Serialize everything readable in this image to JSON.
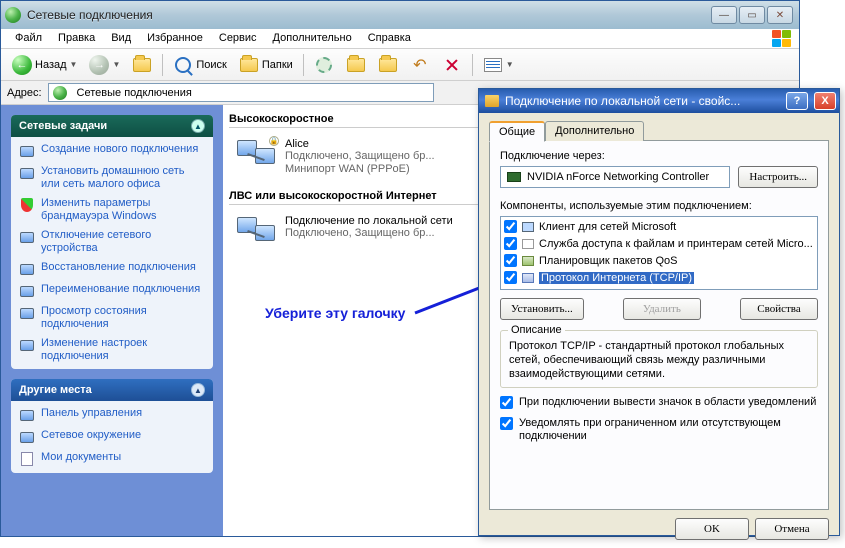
{
  "window": {
    "title": "Сетевые подключения",
    "menu": [
      "Файл",
      "Правка",
      "Вид",
      "Избранное",
      "Сервис",
      "Дополнительно",
      "Справка"
    ],
    "toolbar": {
      "back": "Назад",
      "search": "Поиск",
      "folders": "Папки"
    },
    "address_label": "Адрес:",
    "address_value": "Сетевые подключения"
  },
  "sidebar": {
    "tasks_heading": "Сетевые задачи",
    "tasks": [
      "Создание нового подключения",
      "Установить домашнюю сеть или сеть малого офиса",
      "Изменить параметры брандмауэра Windows",
      "Отключение сетевого устройства",
      "Восстановление подключения",
      "Переименование подключения",
      "Просмотр состояния подключения",
      "Изменение настроек подключения"
    ],
    "other_heading": "Другие места",
    "other": [
      "Панель управления",
      "Сетевое окружение",
      "Мои документы"
    ]
  },
  "content": {
    "group1": "Высокоскоростное",
    "conn1": {
      "name": "Alice",
      "line1": "Подключено, Защищено бр...",
      "line2": "Минипорт WAN (PPPoE)"
    },
    "group2": "ЛВС или высокоскоростной Интернет",
    "conn2": {
      "name": "Подключение по локальной сети",
      "line1": "Подключено, Защищено бр..."
    }
  },
  "annotation": "Уберите эту галочку",
  "dialog": {
    "title": "Подключение по локальной сети - свойс...",
    "tabs": [
      "Общие",
      "Дополнительно"
    ],
    "connect_via": "Подключение через:",
    "adapter": "NVIDIA nForce Networking Controller",
    "configure": "Настроить...",
    "components_label": "Компоненты, используемые этим подключением:",
    "components": [
      "Клиент для сетей Microsoft",
      "Служба доступа к файлам и принтерам сетей Micro...",
      "Планировщик пакетов QoS",
      "Протокол Интернета (TCP/IP)"
    ],
    "install": "Установить...",
    "remove": "Удалить",
    "properties": "Свойства",
    "desc_heading": "Описание",
    "desc": "Протокол TCP/IP - стандартный протокол глобальных сетей, обеспечивающий связь между различными взаимодействующими сетями.",
    "opt1": "При подключении вывести значок в области уведомлений",
    "opt2": "Уведомлять при ограниченном или отсутствующем подключении",
    "ok": "OK",
    "cancel": "Отмена"
  }
}
